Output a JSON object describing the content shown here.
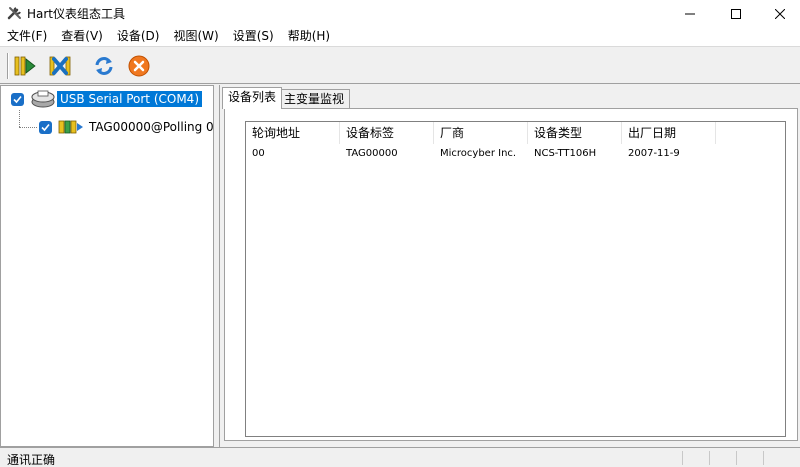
{
  "window": {
    "title": "Hart仪表组态工具",
    "icon": "wrench-screwdriver-icon"
  },
  "menu": [
    {
      "label": "文件(F)"
    },
    {
      "label": "查看(V)"
    },
    {
      "label": "设备(D)"
    },
    {
      "label": "视图(W)"
    },
    {
      "label": "设置(S)"
    },
    {
      "label": "帮助(H)"
    }
  ],
  "toolbar": {
    "buttons": [
      {
        "name": "connect-button",
        "icon": "connect-icon"
      },
      {
        "name": "disconnect-button",
        "icon": "disconnect-icon"
      },
      {
        "name": "refresh-button",
        "icon": "refresh-icon"
      },
      {
        "name": "stop-button",
        "icon": "stop-icon"
      }
    ]
  },
  "tree": {
    "port": {
      "label": "USB Serial Port (COM4)",
      "checked": true
    },
    "device": {
      "label": "TAG00000@Polling 0",
      "checked": true
    }
  },
  "tabs": [
    {
      "label": "设备列表",
      "active": true
    },
    {
      "label": "主变量监视",
      "active": false
    }
  ],
  "device_table": {
    "columns": [
      "轮询地址",
      "设备标签",
      "厂商",
      "设备类型",
      "出厂日期"
    ],
    "rows": [
      [
        "00",
        "TAG00000",
        "Microcyber Inc.",
        "NCS-TT106H",
        "2007-11-9"
      ]
    ]
  },
  "status": {
    "text": "通讯正确"
  },
  "colors": {
    "selection": "#0078d7",
    "checkbox": "#1a6fc7"
  }
}
